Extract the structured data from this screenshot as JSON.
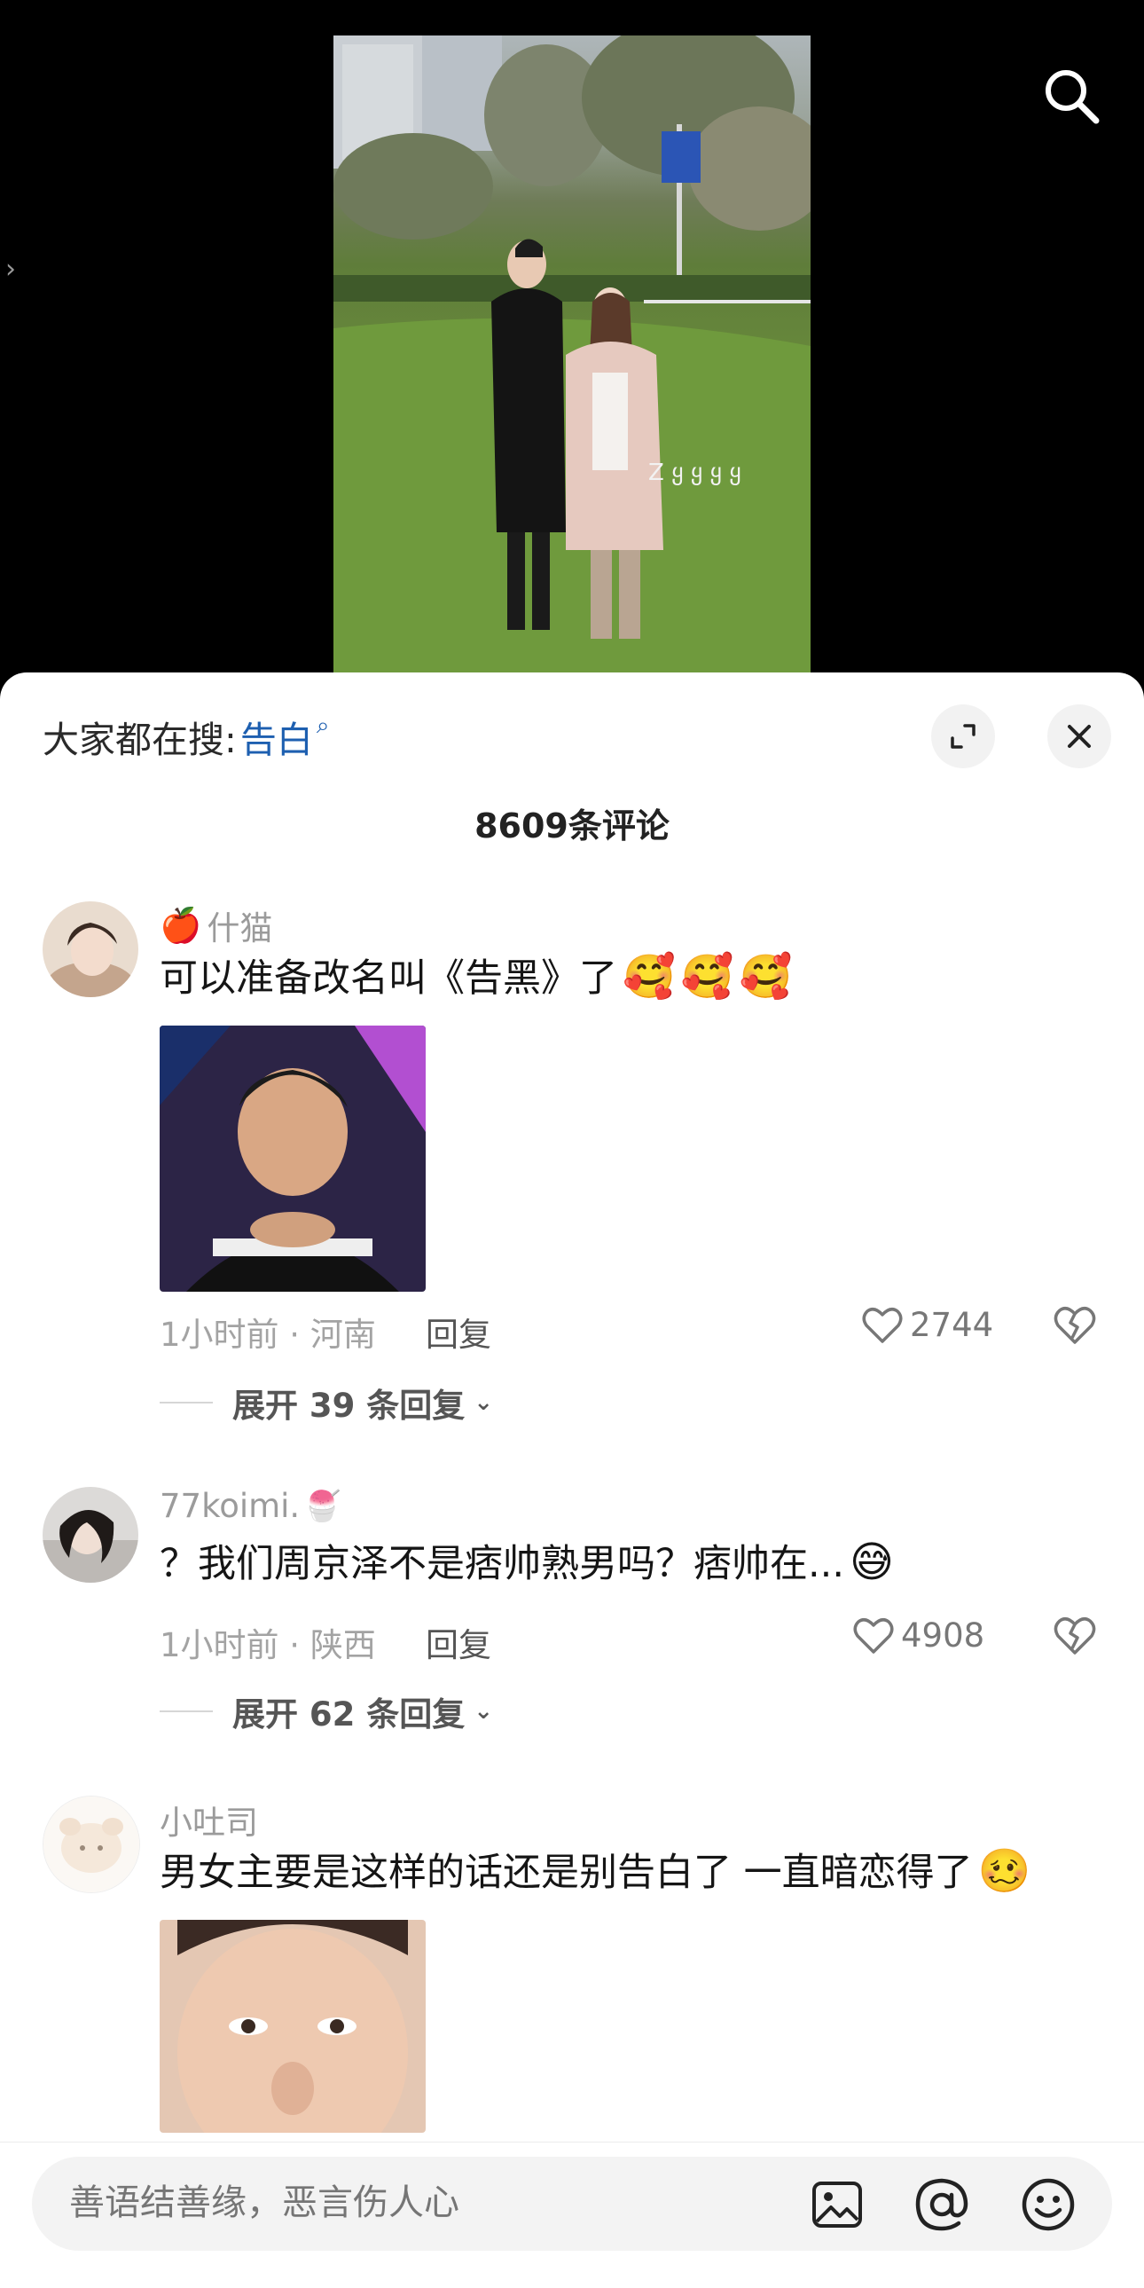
{
  "video": {
    "watermark_text": "Z ყ ყ ყ ყ",
    "icons": {
      "search": "search-icon",
      "side": "chevron-right-icon"
    }
  },
  "sheet": {
    "hot_search_prefix": "大家都在搜:",
    "hot_search_term": "告白",
    "hot_search_term_icon": "⌕",
    "comment_count": "8609条评论"
  },
  "comments": [
    {
      "author": "什猫",
      "author_badge": "🍎",
      "text": "可以准备改名叫《告黑》了",
      "emojis": [
        "🥰",
        "🥰",
        "🥰"
      ],
      "has_sticker": true,
      "time_location": "1小时前 · 河南",
      "reply_label": "回复",
      "likes": "2744",
      "expand_replies": "展开 39 条回复"
    },
    {
      "author": "77koimi.",
      "author_badge_after": "🍧",
      "text": "？我们周京泽不是痞帅熟男吗？痞帅在...",
      "emojis": [
        "😅"
      ],
      "has_sticker": false,
      "time_location": "1小时前 · 陕西",
      "reply_label": "回复",
      "likes": "4908",
      "expand_replies": "展开 62 条回复"
    },
    {
      "author": "小吐司",
      "text": "男女主要是这样的话还是别告白了 一直暗恋得了",
      "emojis": [
        "🥴"
      ],
      "has_sticker": true
    }
  ],
  "input": {
    "placeholder": "善语结善缘，恶言伤人心",
    "icons": [
      "image-icon",
      "at-icon",
      "emoji-icon"
    ]
  },
  "colors": {
    "accent_link": "#1d5fb0",
    "muted_text": "#9b9b9b",
    "sheet_bg": "#ffffff",
    "video_bg": "#000000"
  }
}
